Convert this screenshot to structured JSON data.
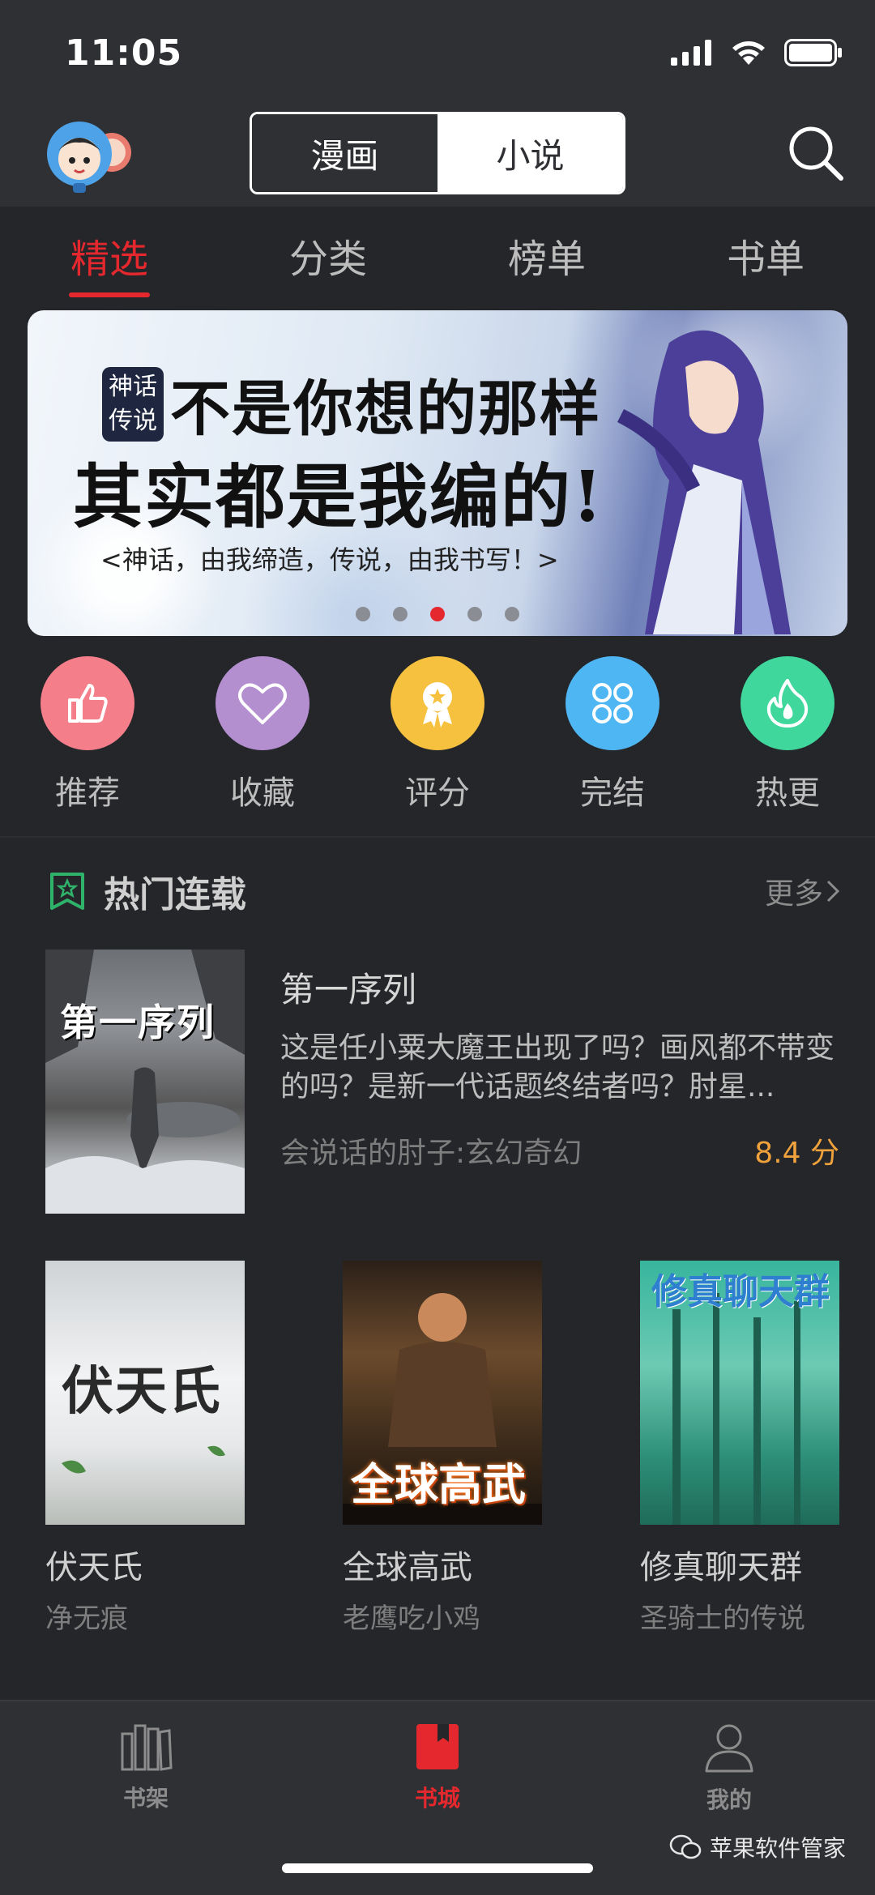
{
  "status_bar": {
    "time": "11:05"
  },
  "header": {
    "segment": [
      {
        "label": "漫画",
        "active": false
      },
      {
        "label": "小说",
        "active": true
      }
    ]
  },
  "tabs": [
    {
      "label": "精选",
      "active": true
    },
    {
      "label": "分类",
      "active": false
    },
    {
      "label": "榜单",
      "active": false
    },
    {
      "label": "书单",
      "active": false
    }
  ],
  "banner": {
    "seal": "神话传说",
    "line1": "不是你想的那样",
    "line2": "其实都是我编的!",
    "subtitle": "<神话，由我缔造，传说，由我书写！>",
    "page_count": 5,
    "active_page": 3
  },
  "quick_menu": [
    {
      "label": "推荐",
      "icon": "thumbs-up-icon",
      "color": "#f47f8a"
    },
    {
      "label": "收藏",
      "icon": "heart-icon",
      "color": "#b48fcf"
    },
    {
      "label": "评分",
      "icon": "medal-icon",
      "color": "#f5c13f"
    },
    {
      "label": "完结",
      "icon": "grid-icon",
      "color": "#4fb6f4"
    },
    {
      "label": "热更",
      "icon": "flame-icon",
      "color": "#3fd79b"
    }
  ],
  "section": {
    "title": "热门连载",
    "more": "更多"
  },
  "featured": {
    "title": "第一序列",
    "description": "这是任小粟大魔王出现了吗？画风都不带变的吗？是新一代话题终结者吗？肘星...",
    "meta": "会说话的肘子:玄幻奇幻",
    "score": "8.4 分",
    "cover_text": "第一序列"
  },
  "books": [
    {
      "title": "伏天氏",
      "author": "净无痕",
      "cover_text": "伏天氏"
    },
    {
      "title": "全球高武",
      "author": "老鹰吃小鸡",
      "cover_text": "全球高武"
    },
    {
      "title": "修真聊天群",
      "author": "圣骑士的传说",
      "cover_text": "修真聊天群"
    }
  ],
  "bottom_nav": [
    {
      "label": "书架",
      "icon": "bookshelf-icon",
      "active": false
    },
    {
      "label": "书城",
      "icon": "bookstore-icon",
      "active": true
    },
    {
      "label": "我的",
      "icon": "profile-icon",
      "active": false
    }
  ],
  "watermark": "苹果软件管家",
  "colors": {
    "accent": "#e5282e",
    "score": "#f0a23c",
    "background": "#25262a",
    "bar": "#2f3034"
  }
}
